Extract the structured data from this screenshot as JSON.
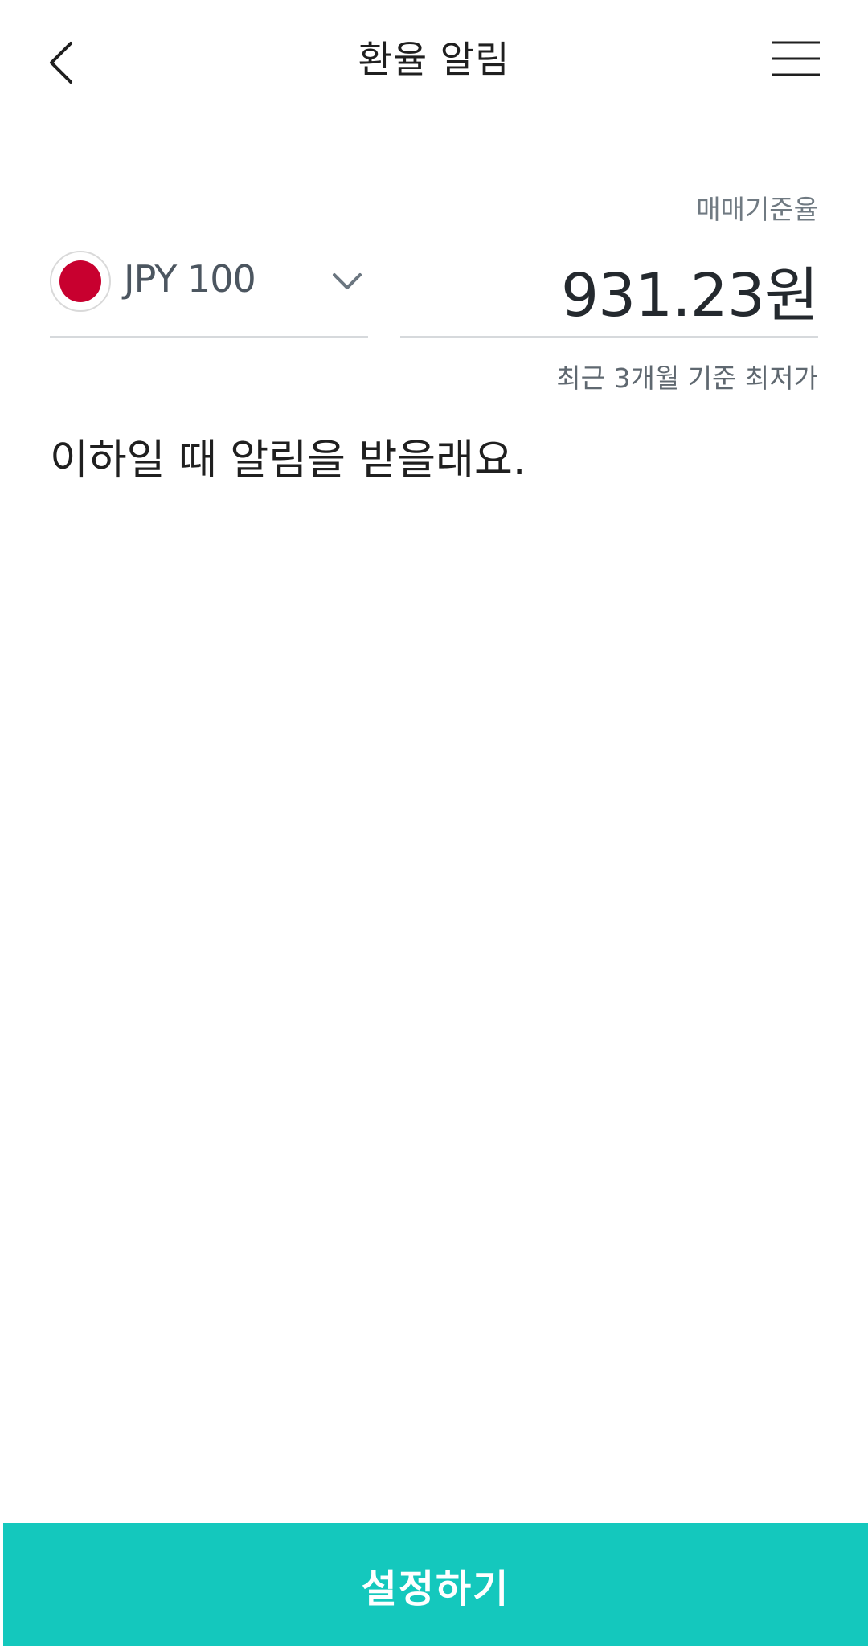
{
  "header": {
    "title": "환율 알림",
    "back_icon": "chevron-left-icon",
    "menu_icon": "hamburger-menu-icon"
  },
  "rate": {
    "label": "매매기준율",
    "currency": "JPY 100",
    "value": "931.23원",
    "caption": "최근 3개월 기준 최저가",
    "flag_color": "#c8002f"
  },
  "alert": {
    "text": "이하일 때 알림을 받을래요."
  },
  "footer": {
    "submit_label": "설정하기",
    "accent_color": "#14c8bd"
  }
}
